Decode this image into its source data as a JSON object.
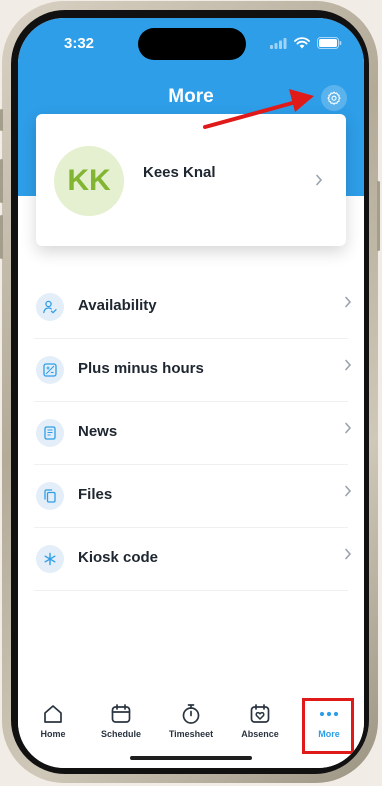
{
  "status_bar": {
    "time": "3:32"
  },
  "header": {
    "title": "More"
  },
  "profile": {
    "initials": "KK",
    "name": "Kees Knal"
  },
  "menu": [
    {
      "label": "Availability",
      "icon": "person-check-icon"
    },
    {
      "label": "Plus minus hours",
      "icon": "plus-minus-icon"
    },
    {
      "label": "News",
      "icon": "newspaper-icon"
    },
    {
      "label": "Files",
      "icon": "files-icon"
    },
    {
      "label": "Kiosk code",
      "icon": "asterisk-icon"
    }
  ],
  "tabbar": [
    {
      "label": "Home",
      "icon": "home-icon"
    },
    {
      "label": "Schedule",
      "icon": "calendar-icon"
    },
    {
      "label": "Timesheet",
      "icon": "stopwatch-icon"
    },
    {
      "label": "Absence",
      "icon": "calendar-heart-icon"
    },
    {
      "label": "More",
      "icon": "more-dots-icon",
      "active": true
    }
  ],
  "colors": {
    "primary": "#2e9ee8",
    "annotation": "#e01919",
    "avatar_bg": "#e4f0cf",
    "avatar_text": "#82b532"
  }
}
